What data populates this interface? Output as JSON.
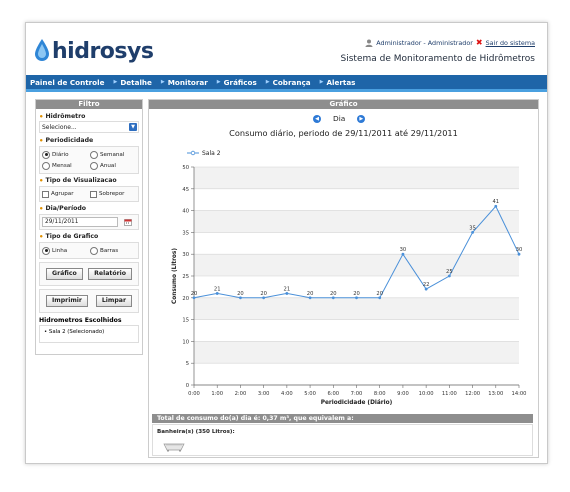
{
  "header": {
    "brand": "hidrosys",
    "user_label": "Administrador - Administrador",
    "logout_label": "Sair do sistema",
    "system_title": "Sistema de Monitoramento de Hidrômetros"
  },
  "nav": {
    "items": [
      {
        "label": "Painel de Controle"
      },
      {
        "label": "Detalhe"
      },
      {
        "label": "Monitorar"
      },
      {
        "label": "Gráficos"
      },
      {
        "label": "Cobrança"
      },
      {
        "label": "Alertas"
      }
    ]
  },
  "filter": {
    "title": "Filtro",
    "hidrometro": {
      "label": "Hidrômetro",
      "value": "Selecione..."
    },
    "periodicidade": {
      "label": "Periodicidade",
      "options": [
        {
          "label": "Diário",
          "selected": true
        },
        {
          "label": "Semanal",
          "selected": false
        },
        {
          "label": "Mensal",
          "selected": false
        },
        {
          "label": "Anual",
          "selected": false
        }
      ]
    },
    "visualizacao": {
      "label": "Tipo de Visualizacao",
      "options": [
        {
          "label": "Agrupar"
        },
        {
          "label": "Sobrepor"
        }
      ]
    },
    "dia": {
      "label": "Dia/Período",
      "value": "29/11/2011"
    },
    "tipo_grafico": {
      "label": "Tipo de Grafico",
      "options": [
        {
          "label": "Linha",
          "selected": true
        },
        {
          "label": "Barras",
          "selected": false
        }
      ]
    },
    "buttons": {
      "grafico": "Gráfico",
      "relatorio": "Relatório",
      "imprimir": "Imprimir",
      "limpar": "Limpar"
    },
    "escolhidos": {
      "title": "Hidrometros Escolhidos",
      "items": [
        "Sala 2 (Selecionado)"
      ]
    }
  },
  "graph": {
    "panel_title": "Gráfico",
    "period_label": "Dia",
    "title": "Consumo diário, periodo de 29/11/2011 até 29/11/2011",
    "totals_text": "Total de consumo do(a) dia é: 0,37 m³, que equivalem a:",
    "equivalence_label": "Banheira(s) (350 Litros):"
  },
  "chart_data": {
    "type": "line",
    "title": "Consumo diário, periodo de 29/11/2011 até 29/11/2011",
    "xlabel": "Periodicidade (Diário)",
    "ylabel": "Consumo (Litros)",
    "categories": [
      "0:00",
      "1:00",
      "2:00",
      "3:00",
      "4:00",
      "5:00",
      "6:00",
      "7:00",
      "8:00",
      "9:00",
      "10:00",
      "11:00",
      "12:00",
      "13:00",
      "14:00"
    ],
    "series": [
      {
        "name": "Sala 2",
        "values": [
          20,
          21,
          20,
          20,
          21,
          20,
          20,
          20,
          20,
          30,
          22,
          25,
          35,
          41,
          30
        ]
      }
    ],
    "ylim": [
      0,
      50
    ],
    "yticks": [
      0,
      5,
      10,
      15,
      20,
      25,
      30,
      35,
      40,
      45,
      50
    ],
    "legend": "top-left",
    "grid": true,
    "line_color": "#4a90d9"
  }
}
